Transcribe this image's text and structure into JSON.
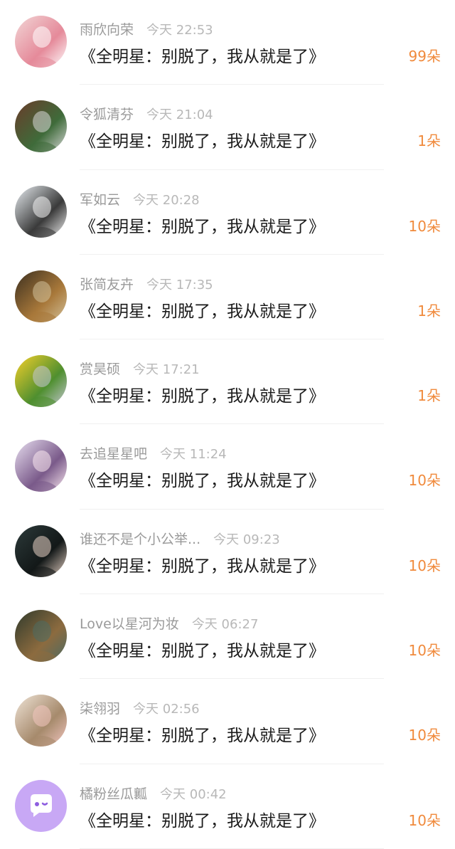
{
  "comments": [
    {
      "user": "雨欣向荣",
      "time": "今天 22:53",
      "text": "《全明星：别脱了，我从就是了》",
      "flowers": "99朵",
      "avatar": "pink-portrait-avatar",
      "avatar_colors": [
        "#f2d6d6",
        "#e58a9a",
        "#ffffff"
      ]
    },
    {
      "user": "令狐清芬",
      "time": "今天 21:04",
      "text": "《全明星：别脱了，我从就是了》",
      "flowers": "1朵",
      "avatar": "street-sign-avatar",
      "avatar_colors": [
        "#6a3b2a",
        "#3f6b3a",
        "#d9d9d9"
      ]
    },
    {
      "user": "军如云",
      "time": "今天 20:28",
      "text": "《全明星：别脱了，我从就是了》",
      "flowers": "10朵",
      "avatar": "girl-portrait-avatar",
      "avatar_colors": [
        "#e9eef2",
        "#3a3a3a",
        "#f4f4f4"
      ]
    },
    {
      "user": "张简友卉",
      "time": "今天 17:35",
      "text": "《全明星：别脱了，我从就是了》",
      "flowers": "1朵",
      "avatar": "warrior-art-avatar",
      "avatar_colors": [
        "#3b2f1f",
        "#a8783a",
        "#d2c19a"
      ]
    },
    {
      "user": "赏昊硕",
      "time": "今天 17:21",
      "text": "《全明星：别脱了，我从就是了》",
      "flowers": "1朵",
      "avatar": "corn-food-avatar",
      "avatar_colors": [
        "#f6d02a",
        "#4f8f2f",
        "#c7c9d6"
      ]
    },
    {
      "user": "去追星星吧",
      "time": "今天 11:24",
      "text": "《全明星：别脱了，我从就是了》",
      "flowers": "10朵",
      "avatar": "anime-girl-avatar",
      "avatar_colors": [
        "#e8dff0",
        "#7a5a8a",
        "#fbe9f0"
      ]
    },
    {
      "user": "谁还不是个小公举...",
      "time": "今天 09:23",
      "text": "《全明星：别脱了，我从就是了》",
      "flowers": "10朵",
      "avatar": "dark-portrait-avatar",
      "avatar_colors": [
        "#2c3a3a",
        "#131818",
        "#e7d2c4"
      ]
    },
    {
      "user": "Love以星河为妆",
      "time": "今天 06:27",
      "text": "《全明星：别脱了，我从就是了》",
      "flowers": "10朵",
      "avatar": "fantasy-art-avatar",
      "avatar_colors": [
        "#2f3a2c",
        "#8c6b3f",
        "#4c6b63"
      ]
    },
    {
      "user": "柒翎羽",
      "time": "今天 02:56",
      "text": "《全明星：别脱了，我从就是了》",
      "flowers": "10朵",
      "avatar": "girl-with-plush-avatar",
      "avatar_colors": [
        "#efe3d6",
        "#a68a6c",
        "#f2c6c0"
      ]
    },
    {
      "user": "橘粉丝瓜瓤",
      "time": "今天 00:42",
      "text": "《全明星：别脱了，我从就是了》",
      "flowers": "10朵",
      "avatar": "default-chat-avatar",
      "avatar_colors": [
        "#c8a8f5",
        "#ffffff",
        "#8e5ee0"
      ]
    }
  ]
}
